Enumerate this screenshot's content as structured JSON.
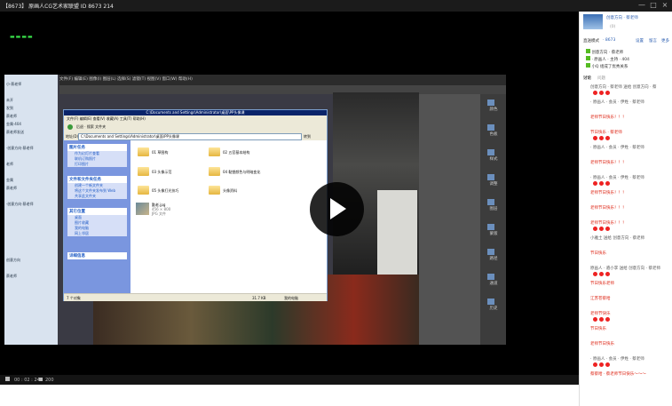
{
  "window": {
    "title": "【8673】 原画人CG艺术家联盟  ID 8673  214",
    "min": "—",
    "max": "□",
    "close": "×"
  },
  "video": {
    "indicator": "▬▬▬▬",
    "time": "00 : 02 : 24",
    "viewers": "200"
  },
  "photoshop": {
    "menu": "文件(F) 编辑(E) 图像(I) 图层(L) 选择(S) 滤镜(T) 视图(V) 窗口(W) 帮助(H)",
    "tools": [
      "颜色",
      "色板",
      "样式",
      "调整",
      "图层",
      "蒙版",
      "路径",
      "通道",
      "历史"
    ]
  },
  "left_panel": {
    "lines": [
      "小·蔡老师",
      "",
      "未开",
      "发到",
      "蔡老师",
      "金属·404",
      "蔡老师发送",
      "",
      "·创意方向·蔡老师",
      "",
      "老师",
      "",
      "金属",
      "蔡老师",
      "",
      "·创意方向·蔡老师",
      "",
      "",
      "",
      "",
      "",
      "",
      "创意方向",
      "",
      "蔡老师"
    ]
  },
  "explorer": {
    "title": "C:\\Documents and Settings\\Administrator\\桌面\\PP头像课",
    "menu": "文件(F)   编辑(E)   查看(V)   收藏(A)   工具(T)   帮助(H)",
    "toolbar": "后退  ·  搜索  文件夹",
    "address_label": "地址(D)",
    "address": "C:\\Documents and Settings\\Administrator\\桌面\\PP头像课",
    "go": "转到",
    "side": [
      {
        "header": "图片任务",
        "items": [
          "作为幻灯片查看",
          "联机订购照片",
          "打印图片"
        ]
      },
      {
        "header": "文件和文件夹任务",
        "items": [
          "创建一个新文件夹",
          "将这个文件夹发布到 Web",
          "共享此文件夹"
        ]
      },
      {
        "header": "其它位置",
        "items": [
          "桌面",
          "图片收藏",
          "我的电脑",
          "网上邻居"
        ]
      },
      {
        "header": "详细信息",
        "items": []
      }
    ],
    "items": [
      {
        "name": "01 草图构"
      },
      {
        "name": "02 五官基本结构"
      },
      {
        "name": "03 头像示范"
      },
      {
        "name": "04 黏塑颜色与明暗变化"
      },
      {
        "name": "05 头像打光技巧"
      },
      {
        "name": "头像资料"
      },
      {
        "name": "勤老.jpg",
        "meta": "456 × 800",
        "type": "JPG 文件"
      }
    ],
    "status_left": "7 个对象",
    "status_size": "31.7 KB",
    "status_loc": "我的电脑"
  },
  "chat": {
    "header_name": "创意方向 · 蔡老师",
    "header_count": "(0)",
    "mode_label": "直送模式",
    "mode_value": "· 8673",
    "links": [
      "设置",
      "留言",
      "更多"
    ],
    "users": [
      "创意方向 · 蔡老师",
      "· 原画人 · 主持 · 404",
      "小Q 组成了优秀关系"
    ],
    "tab_label": "讨论",
    "tab_sub": "问题",
    "messages": [
      "创意方向 · 蔡老师 送给 创意方向 · 蔡",
      "· 原画人 · 会员 · 伊姓 · 蔡老师",
      "老师节日快乐！！！",
      "节日快乐 · 蔡老师",
      "· 原画人 · 会员 · 伊姓 · 蔡老师",
      "老师节日快乐！！！",
      "· 原画人 · 会员 · 伊姓 · 蔡老师",
      "老师节日快乐！！！",
      "老师节日快乐！！！",
      "老师节日快乐！！！",
      "小雅土 送给 创意方向 · 蔡老师",
      "节日快乐",
      "原画人 · 骆小李 送给 创意方向 · 蔡老师",
      "节日快乐老师",
      "江苏苍蔡哈",
      "老师节快乐",
      "节日快乐",
      "老师节日快乐",
      "· 原画人 · 会员 · 伊姓 · 蔡老师",
      "蔡蔡哈 · 蔡老师节日快乐～～～"
    ]
  },
  "colors": {
    "xp_blue": "#0a246a",
    "task_blue": "#7a96df",
    "chat_red": "#dd2211",
    "chat_blue": "#2a5db0",
    "play_green": "#39e04a"
  }
}
